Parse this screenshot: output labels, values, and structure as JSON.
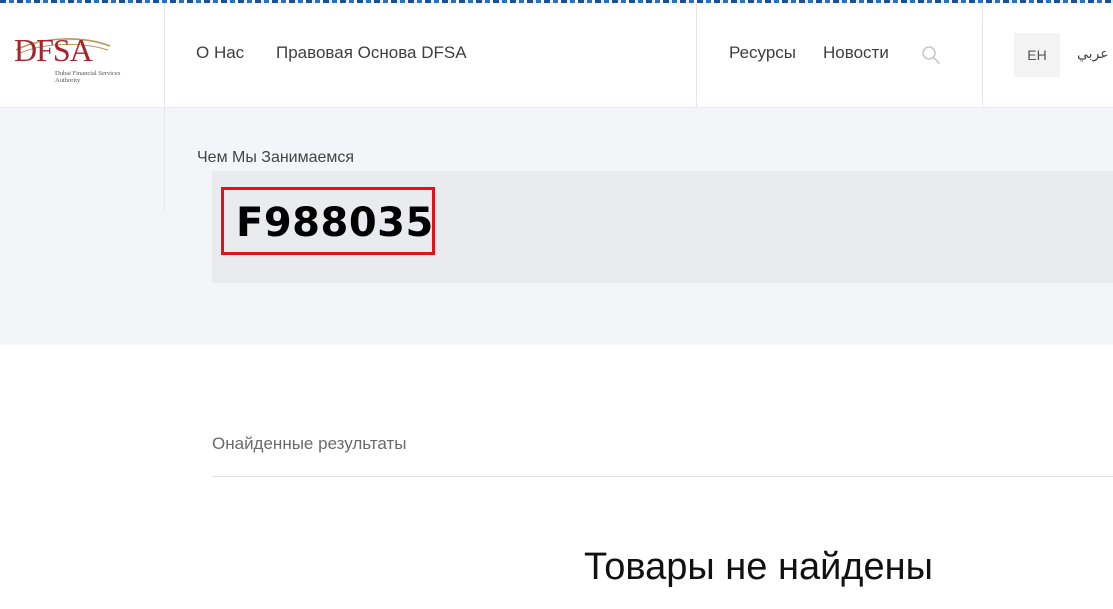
{
  "brand": {
    "logo_text": "DFSA",
    "logo_subtitle": "Dubai Financial Services Authority",
    "accent_color": "#a5242d"
  },
  "nav": {
    "about": "О Нас",
    "legal": "Правовая Основа DFSA",
    "resources": "Ресурсы",
    "news": "Новости"
  },
  "language": {
    "en": "EH",
    "ar": "عربي"
  },
  "hero": {
    "section_title": "Чем Мы Занимаемся",
    "search_query": "F988035"
  },
  "results": {
    "label": "Онайденные результаты",
    "empty_message": "Товары не найдены"
  },
  "icons": {
    "search": "search-icon"
  }
}
